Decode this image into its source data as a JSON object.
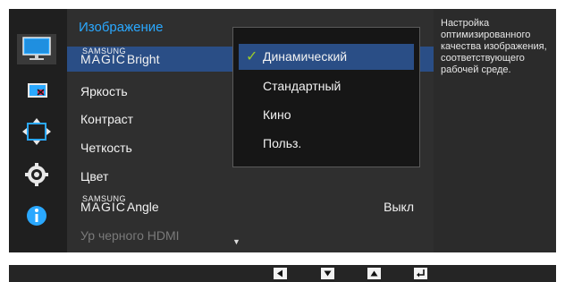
{
  "menu": {
    "title": "Изображение",
    "magic_brand": {
      "small": "SAMSUNG",
      "large": "MAGIC"
    },
    "items": [
      {
        "label": "Bright",
        "magic": true
      },
      {
        "label": "Яркость"
      },
      {
        "label": "Контраст"
      },
      {
        "label": "Четкость"
      },
      {
        "label": "Цвет"
      },
      {
        "label": "Angle",
        "magic": true,
        "value": "Выкл"
      },
      {
        "label": "Ур черного HDMI",
        "disabled": true
      }
    ],
    "more_indicator": "▼"
  },
  "dropdown": {
    "options": [
      "Динамический",
      "Стандартный",
      "Кино",
      "Польз."
    ],
    "selected_index": 0,
    "check_mark": "✓"
  },
  "description": "Настройка оптимизированного качества изображения, соответствующего рабочей среде.",
  "sidebar": {
    "icons": [
      "monitor-icon",
      "color-picture-icon",
      "resize-arrows-icon",
      "settings-gear-icon",
      "info-icon"
    ],
    "active_index": 0
  },
  "bottom_bar": {
    "buttons": [
      "left-arrow-button",
      "down-arrow-button",
      "up-arrow-button",
      "enter-button"
    ]
  },
  "colors": {
    "accent": "#2aa8ff",
    "selection": "#2a4e86",
    "check": "#9ccc2a",
    "background": "#2b2b2b"
  }
}
